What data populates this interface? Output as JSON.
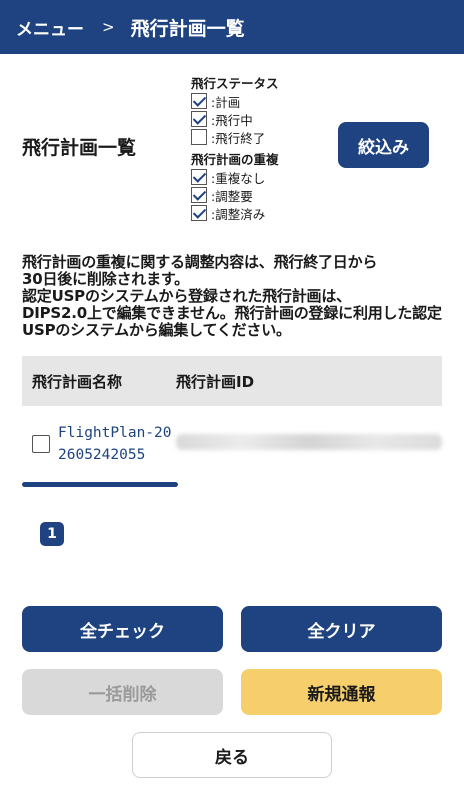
{
  "header": {
    "breadcrumb": "メニュー",
    "separator": ">",
    "title": "飛行計画一覧"
  },
  "page_title": "飛行計画一覧",
  "filters": {
    "status": {
      "title": "飛行ステータス",
      "items": [
        {
          "label": ":計画",
          "checked": true
        },
        {
          "label": ":飛行中",
          "checked": true
        },
        {
          "label": ":飛行終了",
          "checked": false
        }
      ]
    },
    "duplication": {
      "title": "飛行計画の重複",
      "items": [
        {
          "label": ":重複なし",
          "checked": true
        },
        {
          "label": ":調整要",
          "checked": true
        },
        {
          "label": ":調整済み",
          "checked": true
        }
      ]
    },
    "filter_button": "絞込み"
  },
  "notice": "飛行計画の重複に関する調整内容は、飛行終了日から\n30日後に削除されます。\n認定USPのシステムから登録された飛行計画は、\nDIPS2.0上で編集できません。飛行計画の登録に利用した認定USPのシステムから編集してください。",
  "table": {
    "columns": [
      "飛行計画名称",
      "飛行計画ID"
    ],
    "rows": [
      {
        "name": "FlightPlan-202605242055",
        "checked": false
      }
    ]
  },
  "pagination": {
    "current": "1"
  },
  "buttons": {
    "check_all": "全チェック",
    "clear_all": "全クリア",
    "bulk_delete": "一括削除",
    "new_report": "新規通報",
    "back": "戻る"
  },
  "colors": {
    "primary": "#1e4380",
    "accent": "#f6cf6c",
    "disabled": "#d9d9d9"
  }
}
